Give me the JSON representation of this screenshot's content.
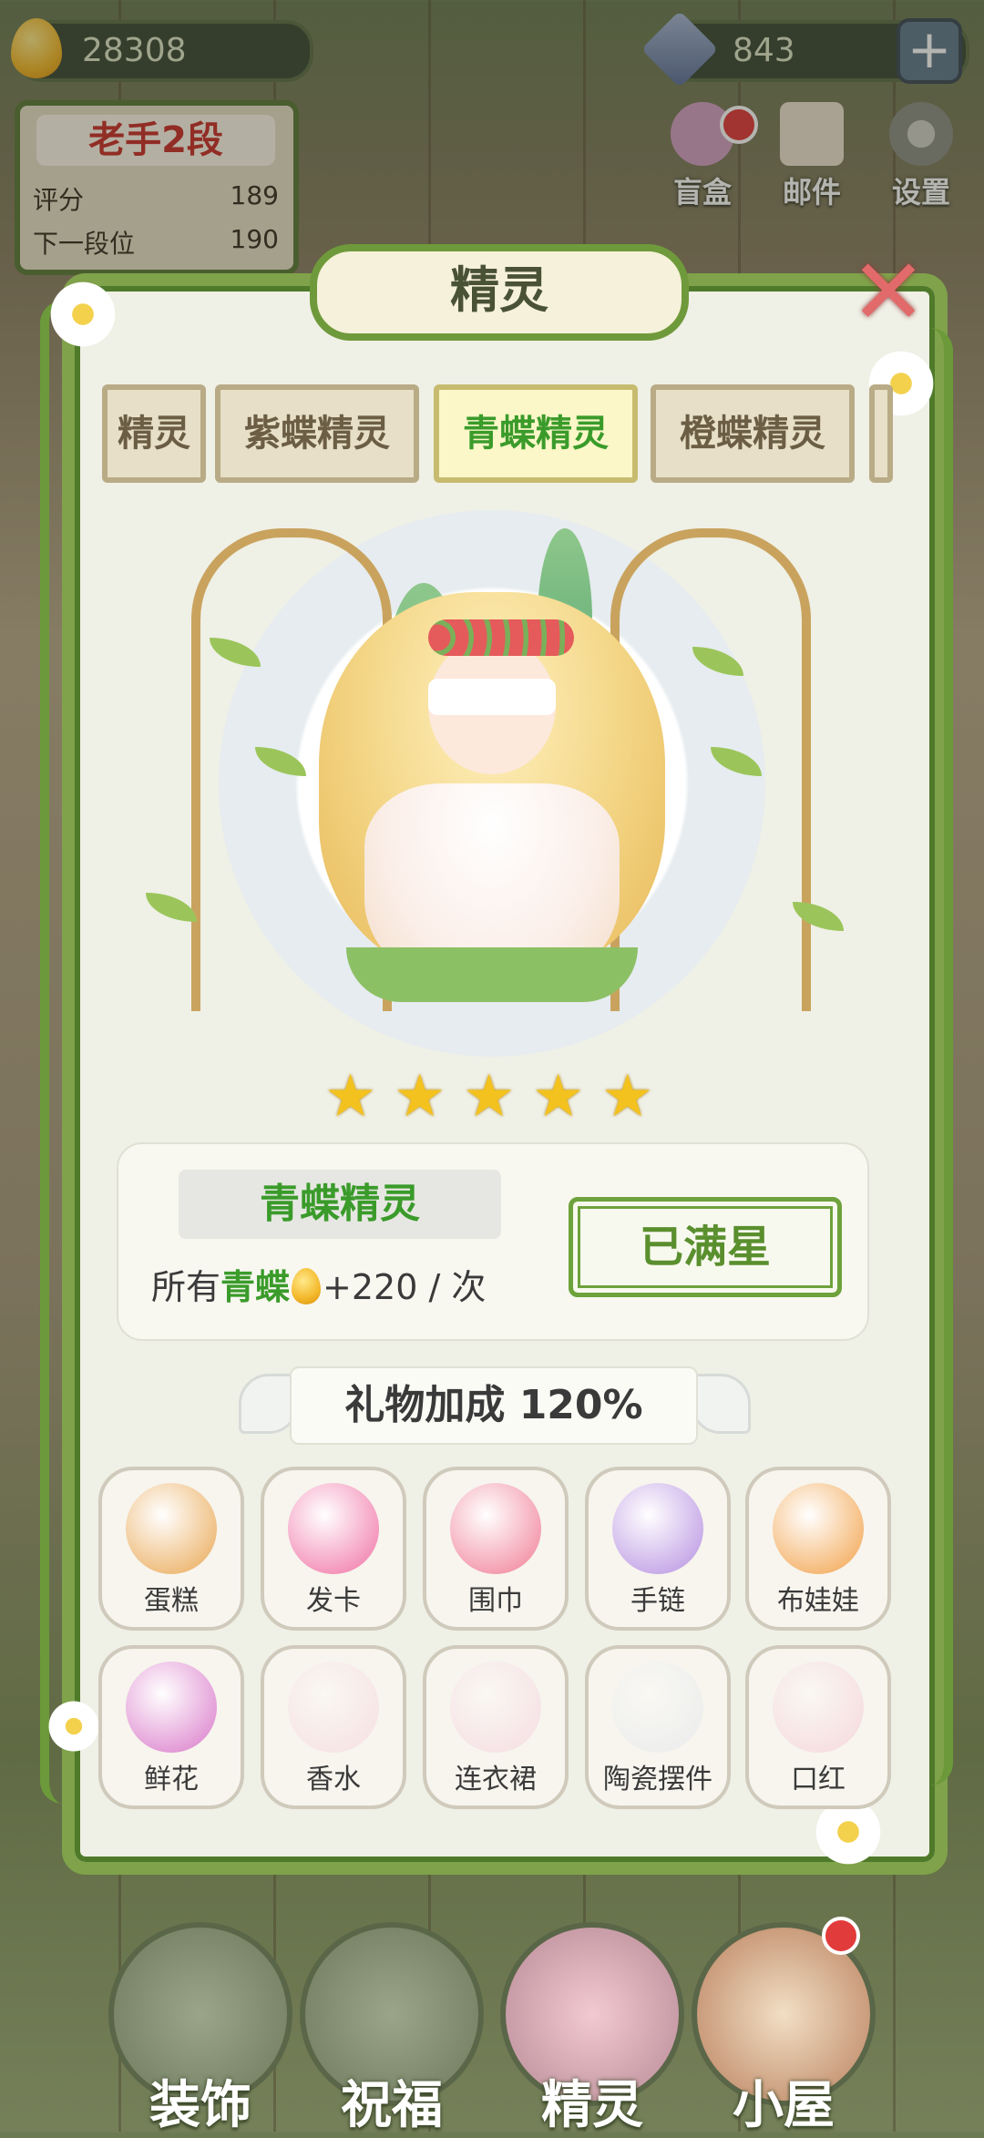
{
  "top_bar": {
    "honey": "28308",
    "gems": "843",
    "plus_label": "+"
  },
  "rank": {
    "title": "老手2段",
    "score_label": "评分",
    "score_value": "189",
    "next_label": "下一段位",
    "next_value": "190"
  },
  "top_icons": [
    {
      "label": "盲盒",
      "icon": "blind-box-icon"
    },
    {
      "label": "邮件",
      "icon": "mail-icon"
    },
    {
      "label": "设置",
      "icon": "gear-icon"
    }
  ],
  "panel": {
    "title": "精灵",
    "close_glyph": "✕",
    "tabs": [
      {
        "label": "精灵",
        "active": false
      },
      {
        "label": "紫蝶精灵",
        "active": false
      },
      {
        "label": "青蝶精灵",
        "active": true
      },
      {
        "label": "橙蝶精灵",
        "active": false
      },
      {
        "label": "",
        "active": false
      }
    ]
  },
  "character": {
    "stars": 5,
    "star_glyph": "★",
    "name": "青蝶精灵",
    "effect_prefix": "所有",
    "effect_target": "青蝶",
    "effect_suffix": "+220 / 次",
    "max_button": "已满星"
  },
  "gift_bonus": "礼物加成  120%",
  "gifts": [
    {
      "label": "蛋糕",
      "icon": "cake-icon",
      "owned": true,
      "color": "#e9a650"
    },
    {
      "label": "发卡",
      "icon": "bow-icon",
      "owned": true,
      "color": "#f06fa3"
    },
    {
      "label": "围巾",
      "icon": "scarf-icon",
      "owned": true,
      "color": "#f07b93"
    },
    {
      "label": "手链",
      "icon": "bracelet-icon",
      "owned": true,
      "color": "#b58ee0"
    },
    {
      "label": "布娃娃",
      "icon": "doll-icon",
      "owned": true,
      "color": "#f2a046"
    },
    {
      "label": "鲜花",
      "icon": "bouquet-icon",
      "owned": true,
      "color": "#d977c8"
    },
    {
      "label": "香水",
      "icon": "perfume-icon",
      "owned": false,
      "color": "#f3b0c2"
    },
    {
      "label": "连衣裙",
      "icon": "dress-icon",
      "owned": false,
      "color": "#f3a8c6"
    },
    {
      "label": "陶瓷摆件",
      "icon": "ceramic-cat-icon",
      "owned": false,
      "color": "#cfd7e6"
    },
    {
      "label": "口红",
      "icon": "lipstick-icon",
      "owned": false,
      "color": "#f39ab0"
    }
  ],
  "bottom_nav": [
    {
      "label": "装饰",
      "icon": "plant-icon",
      "badge": false
    },
    {
      "label": "祝福",
      "icon": "blessing-icon",
      "badge": false
    },
    {
      "label": "精灵",
      "icon": "fairy-icon",
      "badge": false
    },
    {
      "label": "小屋",
      "icon": "house-icon",
      "badge": true
    }
  ],
  "colors": {
    "accent_green": "#3a9b2a",
    "vine_green": "#7fa24a",
    "star_gold": "#f3c21e",
    "rank_red": "#c9302a"
  }
}
